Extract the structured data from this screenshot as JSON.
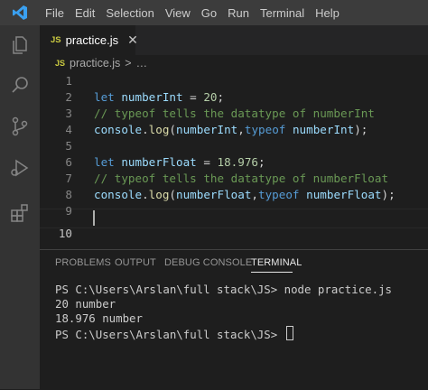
{
  "menu": [
    "File",
    "Edit",
    "Selection",
    "View",
    "Go",
    "Run",
    "Terminal",
    "Help"
  ],
  "tab": {
    "badge": "JS",
    "label": "practice.js",
    "close": "✕"
  },
  "breadcrumb": {
    "badge": "JS",
    "file": "practice.js",
    "sep": ">",
    "more": "…"
  },
  "editor": {
    "lines": [
      {
        "n": "1",
        "tokens": []
      },
      {
        "n": "2",
        "tokens": [
          [
            "kw",
            "let"
          ],
          [
            "txt",
            " "
          ],
          [
            "var",
            "numberInt"
          ],
          [
            "txt",
            " = "
          ],
          [
            "num",
            "20"
          ],
          [
            "txt",
            ";"
          ]
        ]
      },
      {
        "n": "3",
        "tokens": [
          [
            "com",
            "// typeof tells the datatype of numberInt"
          ]
        ]
      },
      {
        "n": "4",
        "tokens": [
          [
            "var",
            "console"
          ],
          [
            "txt",
            "."
          ],
          [
            "fn",
            "log"
          ],
          [
            "txt",
            "("
          ],
          [
            "var",
            "numberInt"
          ],
          [
            "txt",
            ","
          ],
          [
            "kw",
            "typeof"
          ],
          [
            "txt",
            " "
          ],
          [
            "var",
            "numberInt"
          ],
          [
            "txt",
            ");"
          ]
        ]
      },
      {
        "n": "5",
        "tokens": []
      },
      {
        "n": "6",
        "tokens": [
          [
            "kw",
            "let"
          ],
          [
            "txt",
            " "
          ],
          [
            "var",
            "numberFloat"
          ],
          [
            "txt",
            " = "
          ],
          [
            "num",
            "18.976"
          ],
          [
            "txt",
            ";"
          ]
        ]
      },
      {
        "n": "7",
        "tokens": [
          [
            "com",
            "// typeof tells the datatype of numberFloat"
          ]
        ]
      },
      {
        "n": "8",
        "tokens": [
          [
            "var",
            "console"
          ],
          [
            "txt",
            "."
          ],
          [
            "fn",
            "log"
          ],
          [
            "txt",
            "("
          ],
          [
            "var",
            "numberFloat"
          ],
          [
            "txt",
            ","
          ],
          [
            "kw",
            "typeof"
          ],
          [
            "txt",
            " "
          ],
          [
            "var",
            "numberFloat"
          ],
          [
            "txt",
            ");"
          ]
        ]
      },
      {
        "n": "9",
        "tokens": []
      },
      {
        "n": "10",
        "tokens": []
      }
    ]
  },
  "panel": {
    "tabs": [
      "PROBLEMS",
      "OUTPUT",
      "DEBUG CONSOLE",
      "TERMINAL"
    ],
    "active_tab": "TERMINAL",
    "terminal_lines": [
      "PS C:\\Users\\Arslan\\full stack\\JS> node practice.js",
      "20 number",
      "18.976 number",
      "PS C:\\Users\\Arslan\\full stack\\JS> "
    ]
  },
  "icons": {
    "app": "vscode-logo-icon",
    "explorer": "files-icon",
    "search": "search-icon",
    "scm": "source-control-icon",
    "debug": "run-debug-icon",
    "extensions": "extensions-icon"
  },
  "colors": {
    "accent": "#007acc",
    "keyword": "#569cd6",
    "variable": "#9cdcfe",
    "number": "#b5cea8",
    "comment": "#6a9955",
    "function": "#dcdcaa",
    "js_badge": "#cbcb41"
  }
}
